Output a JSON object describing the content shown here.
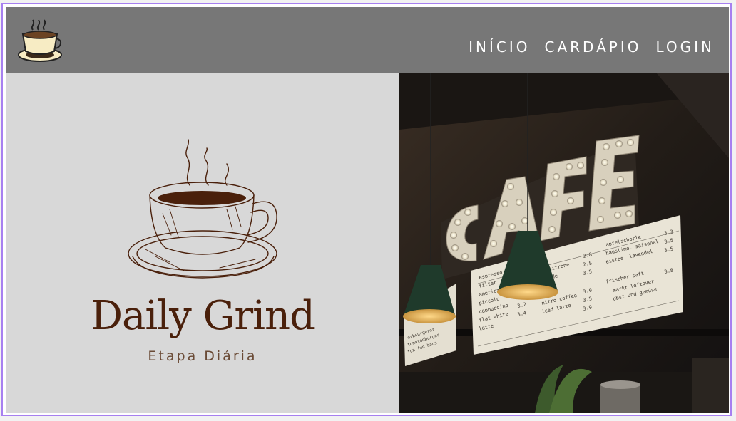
{
  "navbar": {
    "logo_icon": "coffee-cup-icon",
    "links": [
      {
        "label": "INÍCIO"
      },
      {
        "label": "CARDÁPIO"
      },
      {
        "label": "LOGIN"
      }
    ]
  },
  "brand": {
    "title": "Daily Grind",
    "subtitle": "Etapa Diária",
    "icon": "coffee-cup-sketch-icon"
  },
  "photo": {
    "sign": "CAFE",
    "menu_board_main": {
      "left_items": [
        "espresso",
        "filter",
        "americano",
        "piccolo",
        "cappuccino",
        "flat white",
        "latte"
      ],
      "left_prices": [
        "",
        "",
        "",
        "2.6",
        "3.2",
        "3.4",
        ""
      ],
      "mid_items": [
        "zitrone",
        "ide",
        "",
        "",
        "nitro coffee",
        "iced latte"
      ],
      "mid_prices": [
        "2.8",
        "2.8",
        "3.5",
        "3.0",
        "3.5",
        "3.9"
      ],
      "right_items": [
        "apfelschorle",
        "hauslimo. saisonal",
        "eistee. lavendel",
        "frischer saft",
        "markt leftover",
        "obst und gemüse"
      ],
      "right_prices": [
        "3.3",
        "3.5",
        "3.5",
        "3.8",
        "",
        ""
      ]
    },
    "menu_board_small": {
      "items": [
        "orbsurgeror",
        "tomatenburger",
        "fun fun haus"
      ]
    }
  },
  "colors": {
    "navbar": "#777777",
    "left_panel": "#d8d8d8",
    "brand_brown": "#4a200b",
    "frame_border": "#a780f0"
  }
}
